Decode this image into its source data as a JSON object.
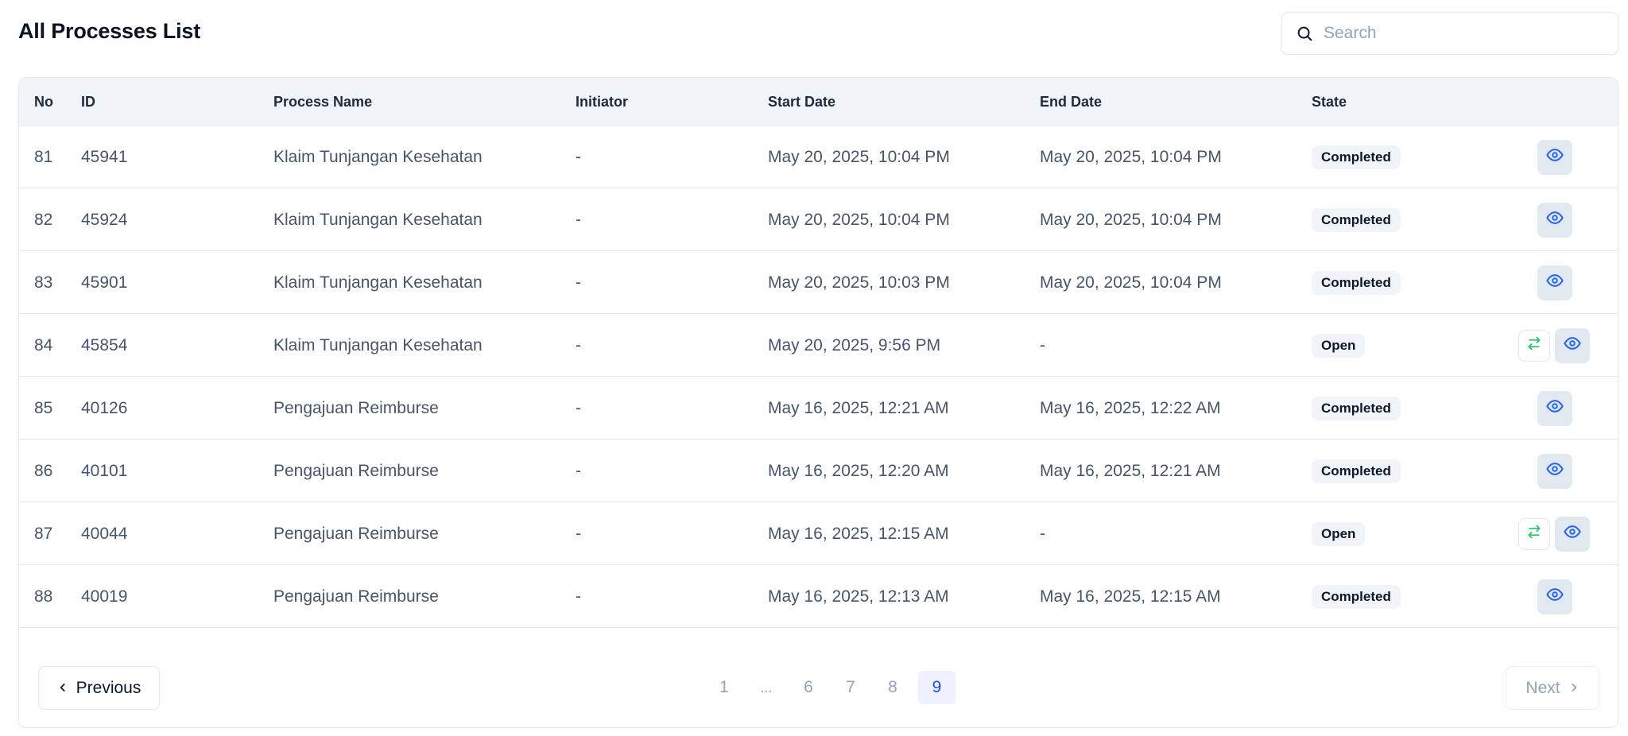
{
  "page": {
    "title": "All Processes List"
  },
  "search": {
    "placeholder": "Search",
    "value": ""
  },
  "table": {
    "headers": {
      "no": "No",
      "id": "ID",
      "process_name": "Process Name",
      "initiator": "Initiator",
      "start_date": "Start Date",
      "end_date": "End Date",
      "state": "State"
    },
    "rows": [
      {
        "no": "81",
        "id": "45941",
        "process_name": "Klaim Tunjangan Kesehatan",
        "initiator": "-",
        "start_date": "May 20, 2025, 10:04 PM",
        "end_date": "May 20, 2025, 10:04 PM",
        "state": "Completed"
      },
      {
        "no": "82",
        "id": "45924",
        "process_name": "Klaim Tunjangan Kesehatan",
        "initiator": "-",
        "start_date": "May 20, 2025, 10:04 PM",
        "end_date": "May 20, 2025, 10:04 PM",
        "state": "Completed"
      },
      {
        "no": "83",
        "id": "45901",
        "process_name": "Klaim Tunjangan Kesehatan",
        "initiator": "-",
        "start_date": "May 20, 2025, 10:03 PM",
        "end_date": "May 20, 2025, 10:04 PM",
        "state": "Completed"
      },
      {
        "no": "84",
        "id": "45854",
        "process_name": "Klaim Tunjangan Kesehatan",
        "initiator": "-",
        "start_date": "May 20, 2025, 9:56 PM",
        "end_date": "-",
        "state": "Open"
      },
      {
        "no": "85",
        "id": "40126",
        "process_name": "Pengajuan Reimburse",
        "initiator": "-",
        "start_date": "May 16, 2025, 12:21 AM",
        "end_date": "May 16, 2025, 12:22 AM",
        "state": "Completed"
      },
      {
        "no": "86",
        "id": "40101",
        "process_name": "Pengajuan Reimburse",
        "initiator": "-",
        "start_date": "May 16, 2025, 12:20 AM",
        "end_date": "May 16, 2025, 12:21 AM",
        "state": "Completed"
      },
      {
        "no": "87",
        "id": "40044",
        "process_name": "Pengajuan Reimburse",
        "initiator": "-",
        "start_date": "May 16, 2025, 12:15 AM",
        "end_date": "-",
        "state": "Open"
      },
      {
        "no": "88",
        "id": "40019",
        "process_name": "Pengajuan Reimburse",
        "initiator": "-",
        "start_date": "May 16, 2025, 12:13 AM",
        "end_date": "May 16, 2025, 12:15 AM",
        "state": "Completed"
      }
    ]
  },
  "pagination": {
    "previous_label": "Previous",
    "next_label": "Next",
    "pages": [
      "1",
      "6",
      "7",
      "8",
      "9"
    ],
    "ellipsis": "...",
    "current_page": "9"
  },
  "icons": {
    "search": "search-icon",
    "view": "eye-icon",
    "transfer": "transfer-arrows-icon",
    "prev": "chevron-left-icon",
    "next": "chevron-right-icon"
  },
  "colors": {
    "view_icon": "#2563eb",
    "transfer_icon": "#22c55e",
    "badge_bg": "#f1f5f9",
    "active_page_bg": "#eef2ff",
    "active_page_text": "#1d4ed8"
  }
}
